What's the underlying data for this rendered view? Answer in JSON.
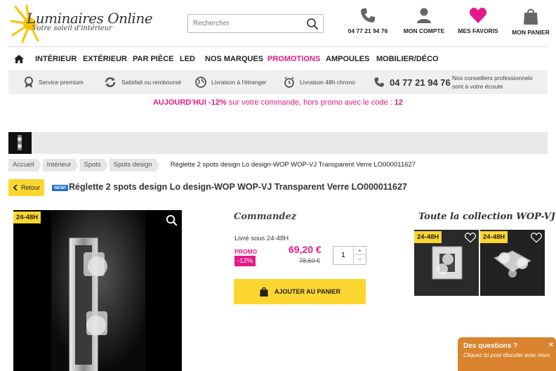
{
  "header": {
    "logo_title": "Luminaires Online",
    "logo_subtitle": "Votre soleil d'intérieur",
    "search_placeholder": "Rechercher",
    "phone": "04 77 21 94 76",
    "account": "MON COMPTE",
    "favorites": "MES FAVORIS",
    "cart": "MON PANIER"
  },
  "nav": {
    "items": [
      "INTÉRIEUR",
      "EXTÉRIEUR",
      "PAR PIÈCE",
      "LED",
      "NOS MARQUES",
      "PROMOTIONS",
      "AMPOULES",
      "MOBILIER/DÉCO"
    ]
  },
  "features": {
    "premium": "Service premium",
    "satisfied": "Satisfait ou remboursé",
    "delivery_abroad": "Livraison à l'étranger",
    "delivery_48h": "Livraison 48h chrono",
    "phone": "04 77 21 94 76",
    "advisors": "Nos conseillers professionnels sont à votre écoute"
  },
  "promo_banner": {
    "lead": "AUJOURD'HUI -12%",
    "middle": " sur votre commande, hors promo avec le code : ",
    "code": "12"
  },
  "breadcrumb": {
    "items": [
      "Accueil",
      "Intérieur",
      "Spots",
      "Spots design"
    ],
    "current": "Réglette 2 spots design Lo design-WOP WOP-VJ Transparent Verre LO000011627"
  },
  "product": {
    "back_label": "Retour",
    "new_badge": "NEW!",
    "title": "Réglette 2 spots design Lo design-WOP WOP-VJ Transparent Verre LO000011627",
    "delivery_tag": "24-48H"
  },
  "order": {
    "title": "Commandez",
    "delivery": "Livré sous 24-48H",
    "promo_label": "PROMO",
    "discount": "-12%",
    "price": "69,20 €",
    "old_price": "78,60 €",
    "quantity": "1",
    "plus": "+",
    "minus": "−",
    "add_to_cart": "AJOUTER AU PANIER"
  },
  "collection": {
    "title": "Toute la collection WOP-VJ",
    "cards": [
      {
        "tag": "24-48H"
      },
      {
        "tag": "24-48H"
      }
    ]
  },
  "chat": {
    "title": "Des questions ?",
    "subtitle": "Cliquez ici pour discuter avec nous",
    "close": "×"
  },
  "colors": {
    "accent_yellow": "#fcd630",
    "accent_pink": "#e6198a",
    "chat_orange": "#d9832f"
  }
}
